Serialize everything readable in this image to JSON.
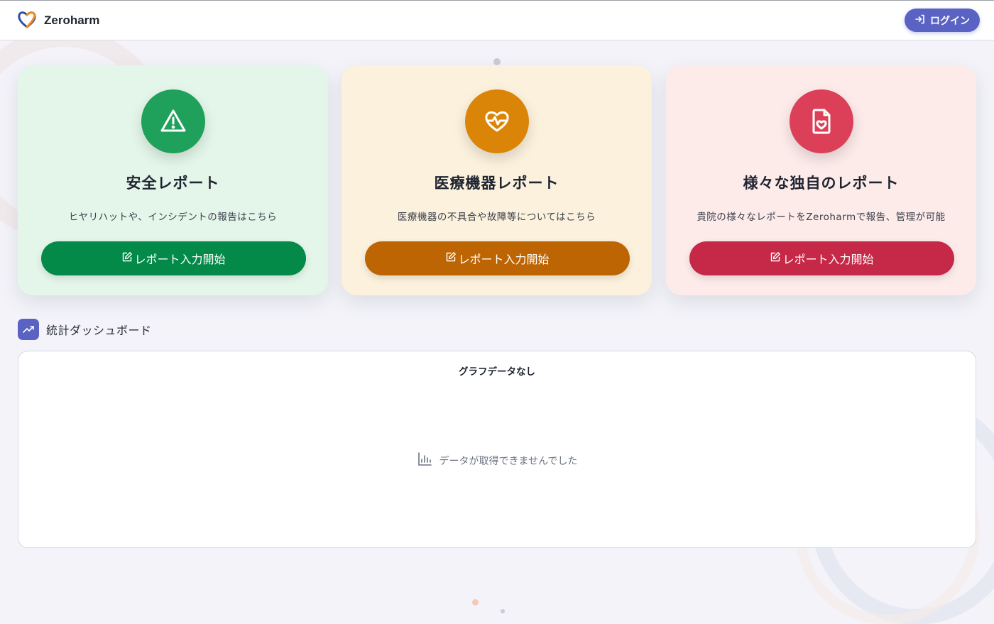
{
  "header": {
    "brand_name": "Zeroharm",
    "logo_icon": "heart-logo-icon",
    "login_label": "ログイン",
    "login_icon": "login-arrow-icon",
    "accent_color": "#5a62c4"
  },
  "cards": [
    {
      "title": "安全レポート",
      "description": "ヒヤリハットや、インシデントの報告はこちら",
      "button_label": "レポート入力開始",
      "icon": "warning-triangle-icon",
      "button_icon": "edit-icon",
      "background": "#e4f6ea",
      "icon_color": "#20a15b",
      "button_color": "#048a48"
    },
    {
      "title": "医療機器レポート",
      "description": "医療機器の不具合や故障等についてはこちら",
      "button_label": "レポート入力開始",
      "icon": "heart-pulse-icon",
      "button_icon": "edit-icon",
      "background": "#fbf1dd",
      "icon_color": "#db8508",
      "button_color": "#bd6403"
    },
    {
      "title": "様々な独自のレポート",
      "description": "貴院の様々なレポートをZeroharmで報告、管理が可能",
      "button_label": "レポート入力開始",
      "icon": "file-heart-icon",
      "button_icon": "edit-icon",
      "background": "#fdebea",
      "icon_color": "#dc4059",
      "button_color": "#c62847"
    }
  ],
  "stats": {
    "title": "統計ダッシュボード",
    "icon": "trending-up-icon",
    "graph_title": "グラフデータなし",
    "empty_message": "データが取得できませんでした",
    "empty_icon": "bar-chart-icon"
  }
}
